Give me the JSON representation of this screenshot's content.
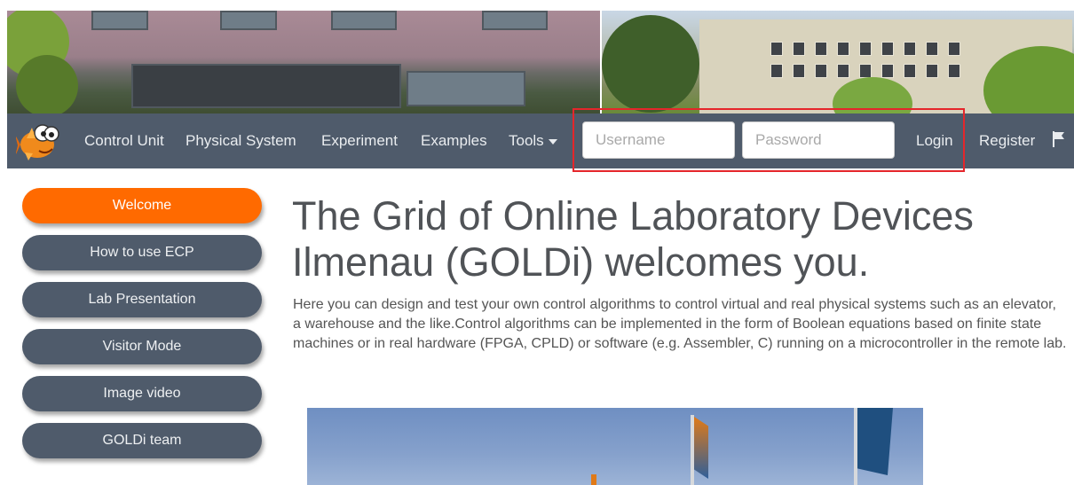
{
  "nav": {
    "logo_icon": "goldi-fish-logo-icon",
    "items": [
      {
        "label": "Control Unit"
      },
      {
        "label": "Physical System"
      },
      {
        "label": "Experiment"
      },
      {
        "label": "Examples"
      },
      {
        "label": "Tools"
      }
    ],
    "username_placeholder": "Username",
    "password_placeholder": "Password",
    "login_label": "Login",
    "register_label": "Register",
    "language_icon": "flag-icon"
  },
  "sidebar": {
    "items": [
      {
        "label": "Welcome",
        "active": true
      },
      {
        "label": "How to use ECP"
      },
      {
        "label": "Lab Presentation"
      },
      {
        "label": "Visitor Mode"
      },
      {
        "label": "Image video"
      },
      {
        "label": "GOLDi team"
      }
    ]
  },
  "main": {
    "title": "The Grid of Online Laboratory Devices Ilmenau (GOLDi) welcomes you.",
    "description": "Here you can design and test your own control algorithms to control virtual and real physical systems such as an elevator, a warehouse and the like.Control algorithms can be implemented in the form of Boolean equations based on finite state machines or in real hardware (FPGA, CPLD) or software (e.g. Assembler, C) running on a microcontroller in the remote lab."
  },
  "colors": {
    "navbar": "#4f5b6b",
    "accent": "#ff6a00",
    "highlight": "#e5262b"
  }
}
